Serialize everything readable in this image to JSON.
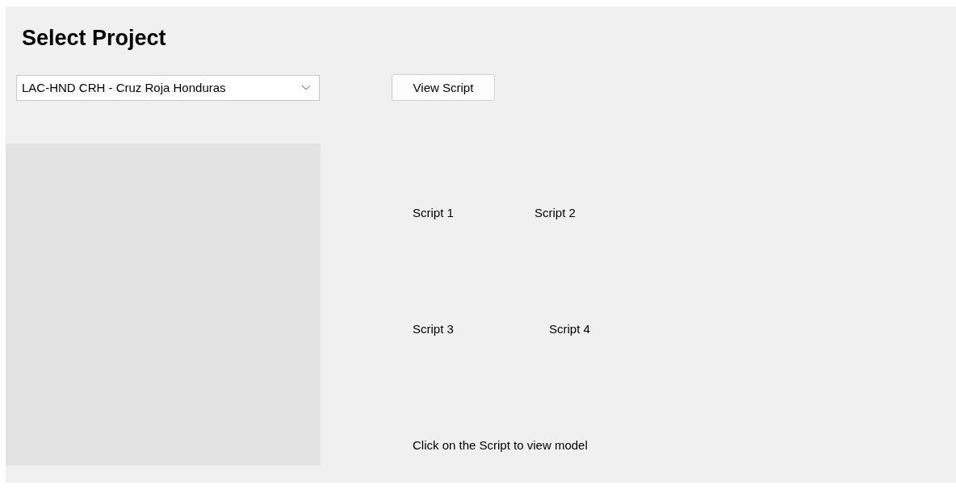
{
  "title": "Select Project",
  "project_select": {
    "value": "LAC-HND CRH - Cruz Roja Honduras"
  },
  "view_button": {
    "label": "View Script"
  },
  "scripts": [
    {
      "label": "Script 1"
    },
    {
      "label": "Script 2"
    },
    {
      "label": "Script 3"
    },
    {
      "label": "Script 4"
    }
  ],
  "hint": "Click on the Script to view model"
}
